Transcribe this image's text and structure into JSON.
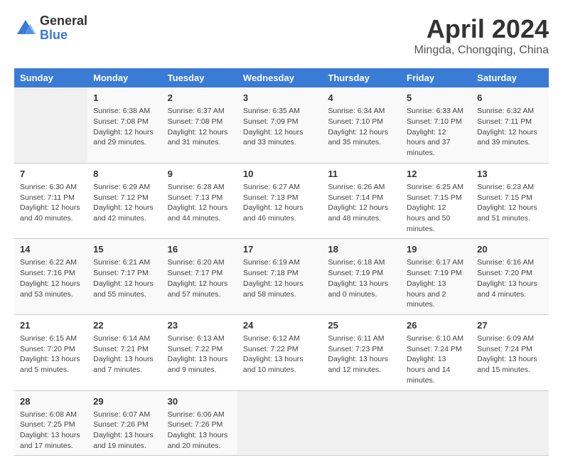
{
  "logo": {
    "line1": "General",
    "line2": "Blue"
  },
  "title": "April 2024",
  "subtitle": "Mingda, Chongqing, China",
  "weekdays": [
    "Sunday",
    "Monday",
    "Tuesday",
    "Wednesday",
    "Thursday",
    "Friday",
    "Saturday"
  ],
  "rows": [
    [
      {
        "day": "",
        "sunrise": "",
        "sunset": "",
        "daylight": ""
      },
      {
        "day": "1",
        "sunrise": "Sunrise: 6:38 AM",
        "sunset": "Sunset: 7:08 PM",
        "daylight": "Daylight: 12 hours and 29 minutes."
      },
      {
        "day": "2",
        "sunrise": "Sunrise: 6:37 AM",
        "sunset": "Sunset: 7:08 PM",
        "daylight": "Daylight: 12 hours and 31 minutes."
      },
      {
        "day": "3",
        "sunrise": "Sunrise: 6:35 AM",
        "sunset": "Sunset: 7:09 PM",
        "daylight": "Daylight: 12 hours and 33 minutes."
      },
      {
        "day": "4",
        "sunrise": "Sunrise: 6:34 AM",
        "sunset": "Sunset: 7:10 PM",
        "daylight": "Daylight: 12 hours and 35 minutes."
      },
      {
        "day": "5",
        "sunrise": "Sunrise: 6:33 AM",
        "sunset": "Sunset: 7:10 PM",
        "daylight": "Daylight: 12 hours and 37 minutes."
      },
      {
        "day": "6",
        "sunrise": "Sunrise: 6:32 AM",
        "sunset": "Sunset: 7:11 PM",
        "daylight": "Daylight: 12 hours and 39 minutes."
      }
    ],
    [
      {
        "day": "7",
        "sunrise": "Sunrise: 6:30 AM",
        "sunset": "Sunset: 7:11 PM",
        "daylight": "Daylight: 12 hours and 40 minutes."
      },
      {
        "day": "8",
        "sunrise": "Sunrise: 6:29 AM",
        "sunset": "Sunset: 7:12 PM",
        "daylight": "Daylight: 12 hours and 42 minutes."
      },
      {
        "day": "9",
        "sunrise": "Sunrise: 6:28 AM",
        "sunset": "Sunset: 7:13 PM",
        "daylight": "Daylight: 12 hours and 44 minutes."
      },
      {
        "day": "10",
        "sunrise": "Sunrise: 6:27 AM",
        "sunset": "Sunset: 7:13 PM",
        "daylight": "Daylight: 12 hours and 46 minutes."
      },
      {
        "day": "11",
        "sunrise": "Sunrise: 6:26 AM",
        "sunset": "Sunset: 7:14 PM",
        "daylight": "Daylight: 12 hours and 48 minutes."
      },
      {
        "day": "12",
        "sunrise": "Sunrise: 6:25 AM",
        "sunset": "Sunset: 7:15 PM",
        "daylight": "Daylight: 12 hours and 50 minutes."
      },
      {
        "day": "13",
        "sunrise": "Sunrise: 6:23 AM",
        "sunset": "Sunset: 7:15 PM",
        "daylight": "Daylight: 12 hours and 51 minutes."
      }
    ],
    [
      {
        "day": "14",
        "sunrise": "Sunrise: 6:22 AM",
        "sunset": "Sunset: 7:16 PM",
        "daylight": "Daylight: 12 hours and 53 minutes."
      },
      {
        "day": "15",
        "sunrise": "Sunrise: 6:21 AM",
        "sunset": "Sunset: 7:17 PM",
        "daylight": "Daylight: 12 hours and 55 minutes."
      },
      {
        "day": "16",
        "sunrise": "Sunrise: 6:20 AM",
        "sunset": "Sunset: 7:17 PM",
        "daylight": "Daylight: 12 hours and 57 minutes."
      },
      {
        "day": "17",
        "sunrise": "Sunrise: 6:19 AM",
        "sunset": "Sunset: 7:18 PM",
        "daylight": "Daylight: 12 hours and 58 minutes."
      },
      {
        "day": "18",
        "sunrise": "Sunrise: 6:18 AM",
        "sunset": "Sunset: 7:19 PM",
        "daylight": "Daylight: 13 hours and 0 minutes."
      },
      {
        "day": "19",
        "sunrise": "Sunrise: 6:17 AM",
        "sunset": "Sunset: 7:19 PM",
        "daylight": "Daylight: 13 hours and 2 minutes."
      },
      {
        "day": "20",
        "sunrise": "Sunrise: 6:16 AM",
        "sunset": "Sunset: 7:20 PM",
        "daylight": "Daylight: 13 hours and 4 minutes."
      }
    ],
    [
      {
        "day": "21",
        "sunrise": "Sunrise: 6:15 AM",
        "sunset": "Sunset: 7:20 PM",
        "daylight": "Daylight: 13 hours and 5 minutes."
      },
      {
        "day": "22",
        "sunrise": "Sunrise: 6:14 AM",
        "sunset": "Sunset: 7:21 PM",
        "daylight": "Daylight: 13 hours and 7 minutes."
      },
      {
        "day": "23",
        "sunrise": "Sunrise: 6:13 AM",
        "sunset": "Sunset: 7:22 PM",
        "daylight": "Daylight: 13 hours and 9 minutes."
      },
      {
        "day": "24",
        "sunrise": "Sunrise: 6:12 AM",
        "sunset": "Sunset: 7:22 PM",
        "daylight": "Daylight: 13 hours and 10 minutes."
      },
      {
        "day": "25",
        "sunrise": "Sunrise: 6:11 AM",
        "sunset": "Sunset: 7:23 PM",
        "daylight": "Daylight: 13 hours and 12 minutes."
      },
      {
        "day": "26",
        "sunrise": "Sunrise: 6:10 AM",
        "sunset": "Sunset: 7:24 PM",
        "daylight": "Daylight: 13 hours and 14 minutes."
      },
      {
        "day": "27",
        "sunrise": "Sunrise: 6:09 AM",
        "sunset": "Sunset: 7:24 PM",
        "daylight": "Daylight: 13 hours and 15 minutes."
      }
    ],
    [
      {
        "day": "28",
        "sunrise": "Sunrise: 6:08 AM",
        "sunset": "Sunset: 7:25 PM",
        "daylight": "Daylight: 13 hours and 17 minutes."
      },
      {
        "day": "29",
        "sunrise": "Sunrise: 6:07 AM",
        "sunset": "Sunset: 7:26 PM",
        "daylight": "Daylight: 13 hours and 19 minutes."
      },
      {
        "day": "30",
        "sunrise": "Sunrise: 6:06 AM",
        "sunset": "Sunset: 7:26 PM",
        "daylight": "Daylight: 13 hours and 20 minutes."
      },
      {
        "day": "",
        "sunrise": "",
        "sunset": "",
        "daylight": ""
      },
      {
        "day": "",
        "sunrise": "",
        "sunset": "",
        "daylight": ""
      },
      {
        "day": "",
        "sunrise": "",
        "sunset": "",
        "daylight": ""
      },
      {
        "day": "",
        "sunrise": "",
        "sunset": "",
        "daylight": ""
      }
    ]
  ]
}
